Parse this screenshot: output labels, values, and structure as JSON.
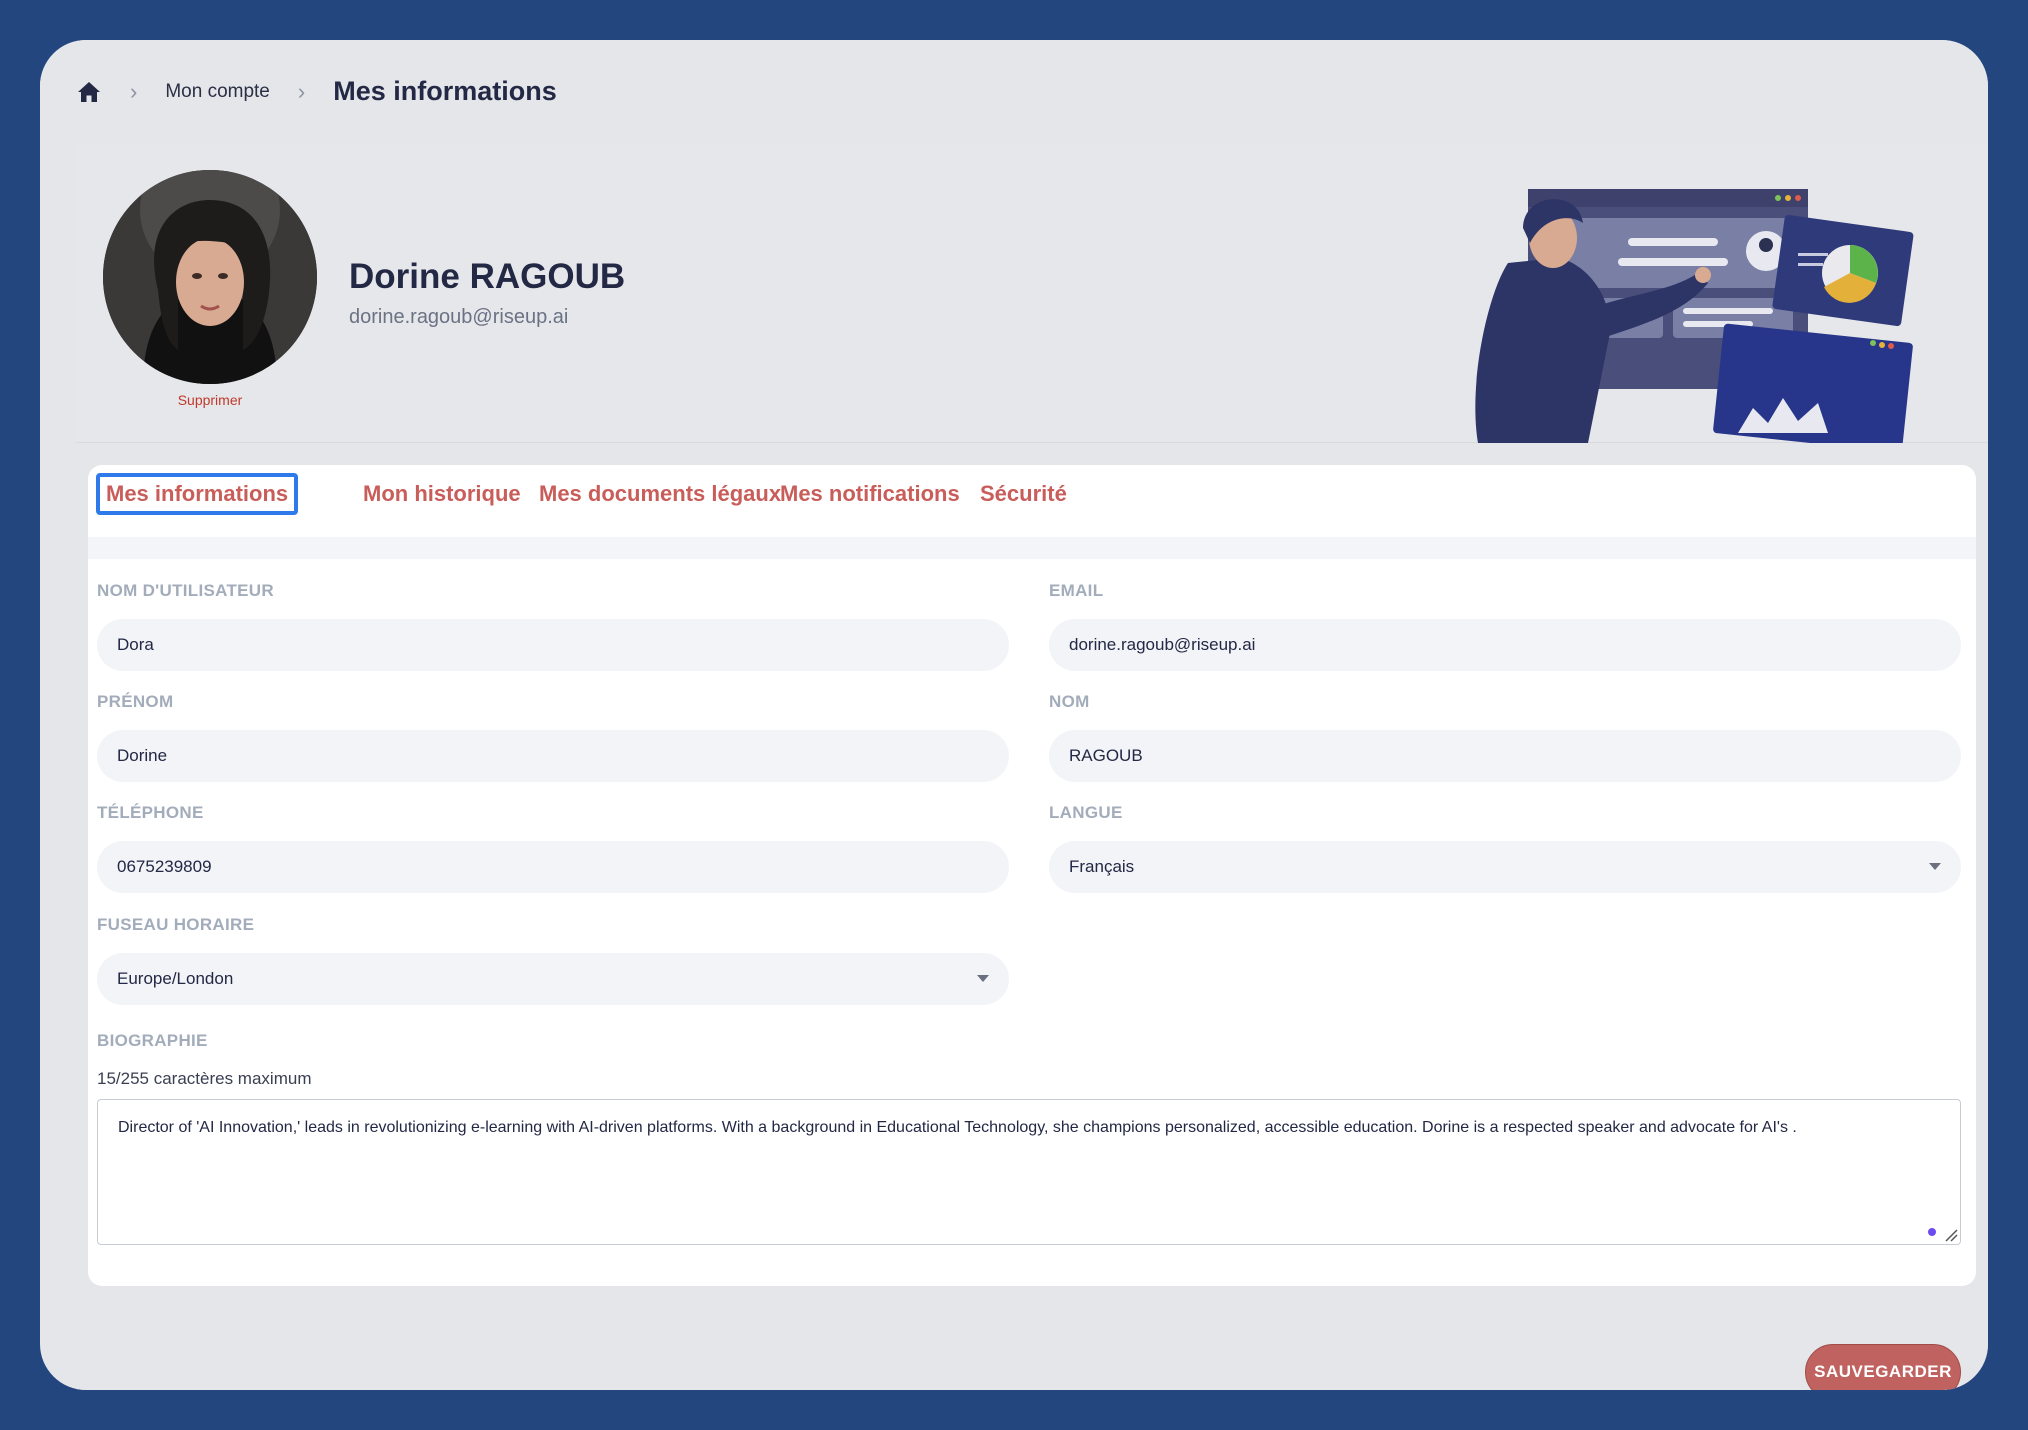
{
  "breadcrumb": {
    "home_icon": "home-icon",
    "items": [
      "Mon compte"
    ],
    "current": "Mes informations"
  },
  "profile": {
    "name": "Dorine RAGOUB",
    "email": "dorine.ragoub@riseup.ai",
    "delete_label": "Supprimer"
  },
  "tabs": [
    {
      "label": "Mes informations",
      "active": true
    },
    {
      "label": "Mon historique",
      "active": false
    },
    {
      "label": "Mes documents légaux",
      "active": false
    },
    {
      "label": "Mes notifications",
      "active": false
    },
    {
      "label": "Sécurité",
      "active": false
    }
  ],
  "form": {
    "username": {
      "label": "NOM D'UTILISATEUR",
      "value": "Dora"
    },
    "email": {
      "label": "EMAIL",
      "value": "dorine.ragoub@riseup.ai"
    },
    "firstname": {
      "label": "PRÉNOM",
      "value": "Dorine"
    },
    "lastname": {
      "label": "NOM",
      "value": "RAGOUB"
    },
    "phone": {
      "label": "TÉLÉPHONE",
      "value": "0675239809"
    },
    "language": {
      "label": "LANGUE",
      "value": "Français"
    },
    "timezone": {
      "label": "FUSEAU HORAIRE",
      "value": "Europe/London"
    },
    "bio": {
      "label": "BIOGRAPHIE",
      "count": "15/255 caractères maximum",
      "value": "Director of 'AI Innovation,' leads in revolutionizing e-learning with AI-driven platforms. With a background in Educational Technology, she champions personalized, accessible education. Dorine is a respected speaker and advocate for AI's ."
    }
  },
  "actions": {
    "save_label": "SAUVEGARDER"
  },
  "colors": {
    "background": "#24467f",
    "accent": "#c85d5a",
    "focus": "#2f7aeb",
    "heading": "#232845"
  }
}
